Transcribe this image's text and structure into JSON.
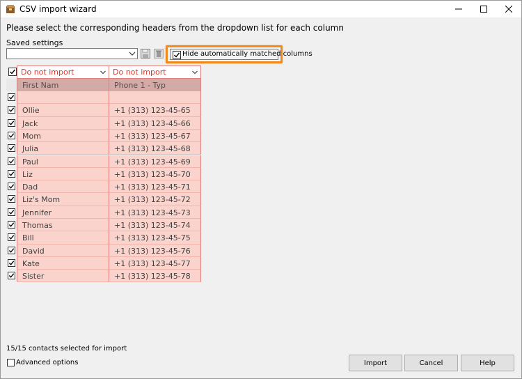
{
  "window": {
    "title": "CSV import wizard",
    "icon": "app-icon"
  },
  "instruction": "Please select the corresponding headers from the dropdown list for each column",
  "saved_settings": {
    "label": "Saved settings",
    "value": ""
  },
  "hide_matched": {
    "label": "Hide automatically matched columns",
    "checked": true
  },
  "table": {
    "column_mappings": [
      "Do not import",
      "Do not import"
    ],
    "headers": [
      "First Nam",
      "Phone 1 - Typ"
    ],
    "rows": [
      {
        "checked": true,
        "first": "",
        "phone": ""
      },
      {
        "checked": true,
        "first": "Ollie",
        "phone": "+1 (313) 123-45-65"
      },
      {
        "checked": true,
        "first": "Jack",
        "phone": "+1 (313) 123-45-66"
      },
      {
        "checked": true,
        "first": "Mom",
        "phone": "+1 (313) 123-45-67"
      },
      {
        "checked": true,
        "first": "Julia",
        "phone": "+1 (313) 123-45-68"
      },
      {
        "checked": true,
        "first": "Paul",
        "phone": "+1 (313) 123-45-69"
      },
      {
        "checked": true,
        "first": "Liz",
        "phone": "+1 (313) 123-45-70"
      },
      {
        "checked": true,
        "first": "Dad",
        "phone": "+1 (313) 123-45-71"
      },
      {
        "checked": true,
        "first": "Liz's Mom",
        "phone": "+1 (313) 123-45-72"
      },
      {
        "checked": true,
        "first": "Jennifer",
        "phone": "+1 (313) 123-45-73"
      },
      {
        "checked": true,
        "first": "Thomas",
        "phone": "+1 (313) 123-45-74"
      },
      {
        "checked": true,
        "first": "Bill",
        "phone": "+1 (313) 123-45-75"
      },
      {
        "checked": true,
        "first": "David",
        "phone": "+1 (313) 123-45-76"
      },
      {
        "checked": true,
        "first": "Kate",
        "phone": "+1 (313) 123-45-77"
      },
      {
        "checked": true,
        "first": "Sister",
        "phone": "+1 (313) 123-45-78"
      }
    ]
  },
  "status": "15/15 contacts selected for import",
  "advanced_options": {
    "label": "Advanced options",
    "checked": false
  },
  "buttons": {
    "import": "Import",
    "cancel": "Cancel",
    "help": "Help"
  },
  "colors": {
    "highlight": "#f08a1d",
    "mapping_text": "#d9382f",
    "cell_fill": "#f9d3cc",
    "header_fill": "#d4aaa7"
  }
}
